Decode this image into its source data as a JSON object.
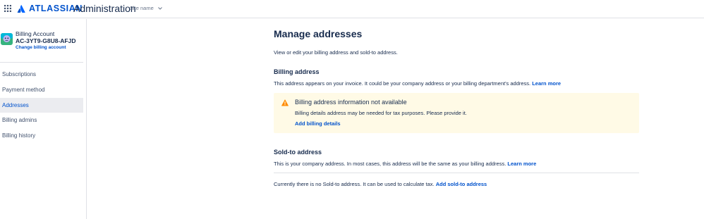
{
  "header": {
    "brand": "ATLASSIAN",
    "title": "Administration",
    "site_select": "Site name",
    "brand_color": "#0052cc"
  },
  "sidebar": {
    "account": {
      "title": "Billing Account",
      "id": "AC-3YT9-G8U8-AFJD",
      "change_link": "Change billing account"
    },
    "items": [
      {
        "label": "Subscriptions",
        "active": false
      },
      {
        "label": "Payment method",
        "active": false
      },
      {
        "label": "Addresses",
        "active": true
      },
      {
        "label": "Billing admins",
        "active": false
      },
      {
        "label": "Billing history",
        "active": false
      }
    ]
  },
  "main": {
    "title": "Manage addresses",
    "description": "View or edit your billing address and sold-to address.",
    "billing": {
      "title": "Billing address",
      "description": "This address appears on your invoice. It could be your company address or your billing department's address.",
      "learn_more": "Learn more",
      "warning": {
        "title": "Billing address information not available",
        "text": "Billing details address may be needed for tax purposes. Please provide it.",
        "action": "Add billing details",
        "background_color": "#fffae6",
        "icon_color": "#ff8b00"
      }
    },
    "sold_to": {
      "title": "Sold-to address",
      "description": "This is your company address. In most cases, this address will be the same as your billing address.",
      "learn_more": "Learn more",
      "empty_text": "Currently there is no Sold-to address. It can be used to calculate tax.",
      "add_link": "Add sold-to address"
    }
  },
  "icons": {
    "app_switcher": "app-switcher-grid-icon",
    "brand": "atlassian-logo-icon",
    "chevron": "chevron-down-icon",
    "avatar": "billing-account-avatar-icon",
    "warning": "warning-triangle-icon"
  }
}
